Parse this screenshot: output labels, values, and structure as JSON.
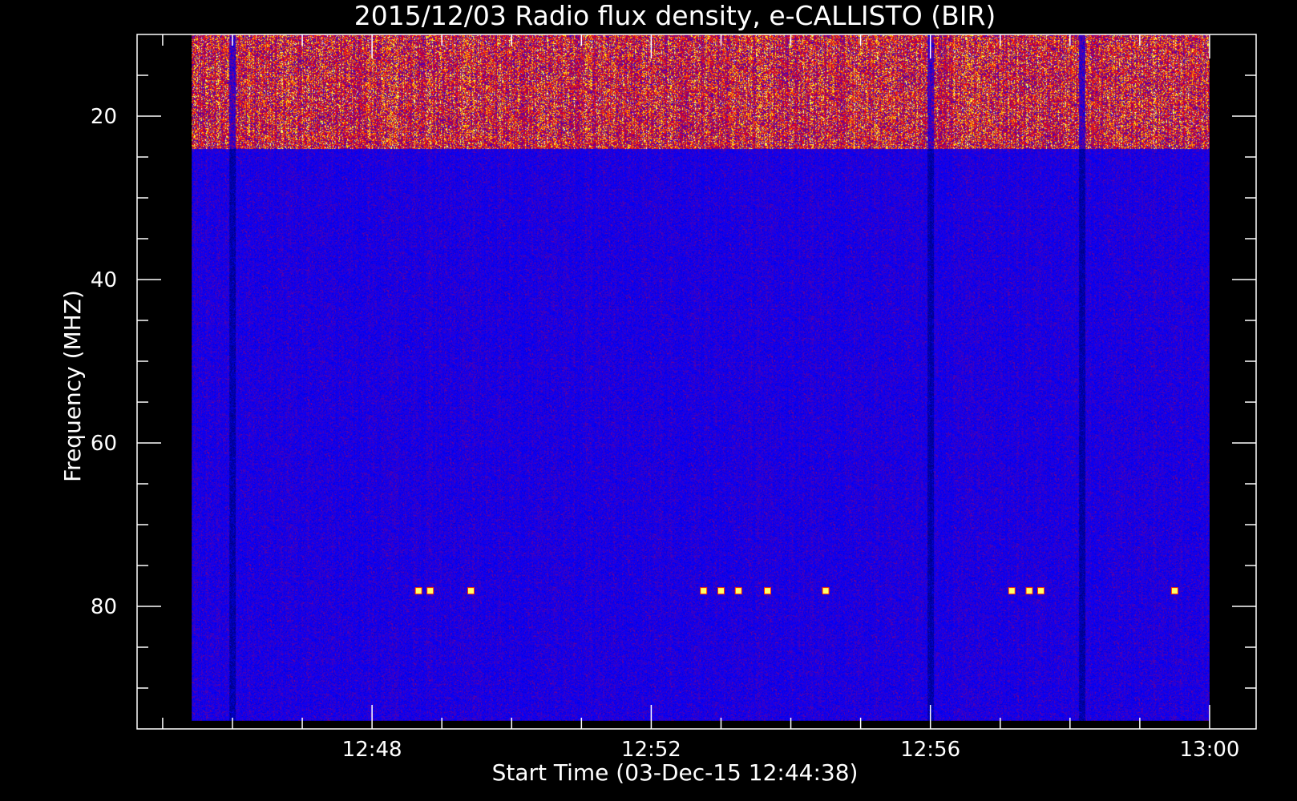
{
  "chart_data": {
    "type": "heatmap",
    "title": "2015/12/03  Radio flux density, e-CALLISTO (BIR)",
    "xlabel": "Start Time (03-Dec-15 12:44:38)",
    "ylabel": "Frequency (MHZ)",
    "x_ticks": [
      "12:48",
      "12:52",
      "12:56",
      "13:00"
    ],
    "y_ticks": [
      "20",
      "40",
      "60",
      "80"
    ],
    "xlim": [
      "12:44:38",
      "13:00:40"
    ],
    "ylim": [
      10,
      95
    ],
    "y_inverted": true,
    "data_time_range": [
      "12:45:25",
      "13:00:00"
    ],
    "data_freq_range": [
      10,
      94
    ],
    "colormap": [
      "#000000",
      "#0000ff",
      "#800080",
      "#ff0000",
      "#ffff00",
      "#ffffff"
    ],
    "background_color": "#1a1ae6",
    "bright_band_freq_range": [
      10,
      24
    ],
    "dark_vertical_bands": [
      "12:46:00",
      "12:56:00",
      "12:58:10"
    ],
    "interference_bursts": [
      {
        "time": "12:48:40",
        "freq": 78
      },
      {
        "time": "12:48:50",
        "freq": 78
      },
      {
        "time": "12:49:25",
        "freq": 78
      },
      {
        "time": "12:52:45",
        "freq": 78
      },
      {
        "time": "12:53:00",
        "freq": 78
      },
      {
        "time": "12:53:15",
        "freq": 78
      },
      {
        "time": "12:53:40",
        "freq": 78
      },
      {
        "time": "12:54:30",
        "freq": 78
      },
      {
        "time": "12:57:10",
        "freq": 78
      },
      {
        "time": "12:57:25",
        "freq": 78
      },
      {
        "time": "12:57:35",
        "freq": 78
      },
      {
        "time": "12:59:30",
        "freq": 78
      }
    ]
  }
}
